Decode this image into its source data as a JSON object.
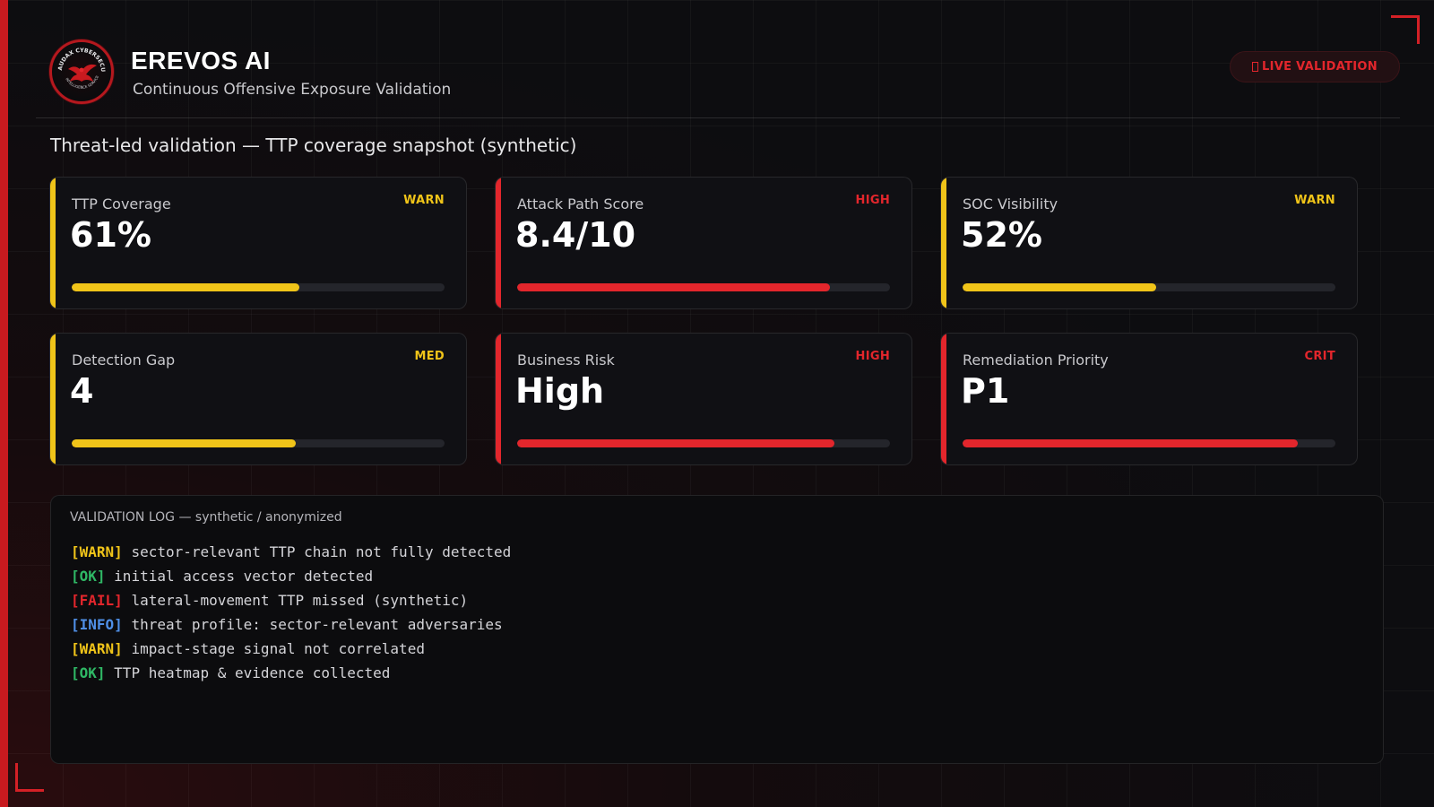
{
  "header": {
    "logo_text": "AUDAX CYBERSECURITY · INTELLIGENCE SERVICES",
    "title": "EREVOS AI",
    "subtitle": "Continuous Offensive Exposure Validation",
    "live_badge": "LIVE VALIDATION"
  },
  "headline": "Threat-led validation — TTP coverage snapshot (synthetic)",
  "colors": {
    "warn": "#f0c419",
    "high": "#e3262c",
    "ok": "#2fb865",
    "info": "#4f8fe6",
    "accent": "#c81a1f"
  },
  "cards": [
    {
      "label": "TTP Coverage",
      "value": "61%",
      "badge": "WARN",
      "level": "warn",
      "progress": 0.61
    },
    {
      "label": "Attack Path Score",
      "value": "8.4/10",
      "badge": "HIGH",
      "level": "high",
      "progress": 0.84
    },
    {
      "label": "SOC Visibility",
      "value": "52%",
      "badge": "WARN",
      "level": "warn",
      "progress": 0.52
    },
    {
      "label": "Detection Gap",
      "value": "4",
      "badge": "MED",
      "level": "warn",
      "progress": 0.6
    },
    {
      "label": "Business Risk",
      "value": "High",
      "badge": "HIGH",
      "level": "high",
      "progress": 0.85
    },
    {
      "label": "Remediation Priority",
      "value": "P1",
      "badge": "CRIT",
      "level": "high",
      "progress": 0.9
    }
  ],
  "log": {
    "title": "VALIDATION LOG — synthetic / anonymized",
    "lines": [
      {
        "tag": "[WARN]",
        "level": "warn",
        "text": "sector-relevant TTP chain not fully detected"
      },
      {
        "tag": "[OK]",
        "level": "ok",
        "text": "initial access vector detected"
      },
      {
        "tag": "[FAIL]",
        "level": "high",
        "text": "lateral-movement TTP missed (synthetic)"
      },
      {
        "tag": "[INFO]",
        "level": "info",
        "text": "threat profile: sector-relevant adversaries"
      },
      {
        "tag": "[WARN]",
        "level": "warn",
        "text": "impact-stage signal not correlated"
      },
      {
        "tag": "[OK]",
        "level": "ok",
        "text": "TTP heatmap & evidence collected"
      }
    ]
  }
}
